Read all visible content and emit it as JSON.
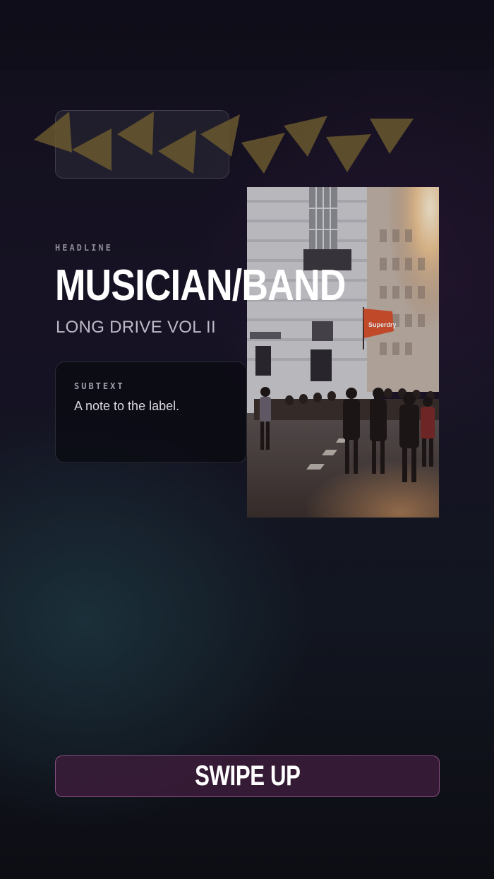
{
  "story": {
    "eyebrow": "HEADLINE",
    "headline": "MUSICIAN/BAND",
    "subheadline": "LONG DRIVE VOL II",
    "note": {
      "label": "SUBTEXT",
      "text": "A note to the label."
    },
    "photo_sign": "Superdry",
    "cta": "SWIPE UP"
  },
  "colors": {
    "accent_triangles": "#6b5a2e",
    "cta_background": "#421e3e",
    "cta_border": "#c878be"
  },
  "icons": {
    "decoration": "triangle-shapes"
  }
}
